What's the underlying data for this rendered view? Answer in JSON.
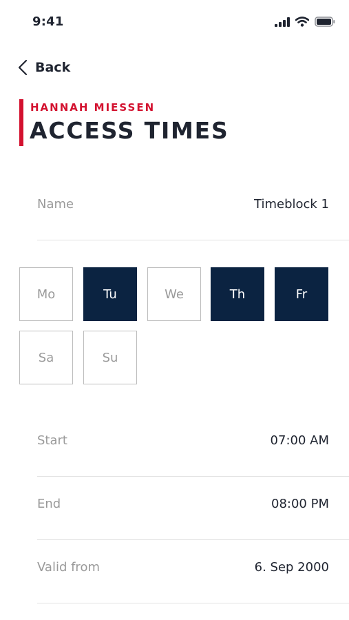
{
  "status": {
    "time": "9:41"
  },
  "nav": {
    "back_label": "Back"
  },
  "header": {
    "subtitle": "HANNAH MIESSEN",
    "title": "ACCESS TIMES"
  },
  "name_row": {
    "label": "Name",
    "value": "Timeblock 1"
  },
  "days": [
    {
      "label": "Mo",
      "selected": false
    },
    {
      "label": "Tu",
      "selected": true
    },
    {
      "label": "We",
      "selected": false
    },
    {
      "label": "Th",
      "selected": true
    },
    {
      "label": "Fr",
      "selected": true
    },
    {
      "label": "Sa",
      "selected": false
    },
    {
      "label": "Su",
      "selected": false
    }
  ],
  "start_row": {
    "label": "Start",
    "value": "07:00 AM"
  },
  "end_row": {
    "label": "End",
    "value": "08:00 PM"
  },
  "valid_row": {
    "label": "Valid from",
    "value": "6. Sep 2000"
  },
  "colors": {
    "accent": "#d3112f",
    "selected_day": "#0b2341",
    "text": "#1f2430",
    "muted": "#9a9a9a"
  },
  "icons": {
    "back": "chevron-left-icon",
    "signal": "cellular-signal-icon",
    "wifi": "wifi-icon",
    "battery": "battery-icon"
  }
}
